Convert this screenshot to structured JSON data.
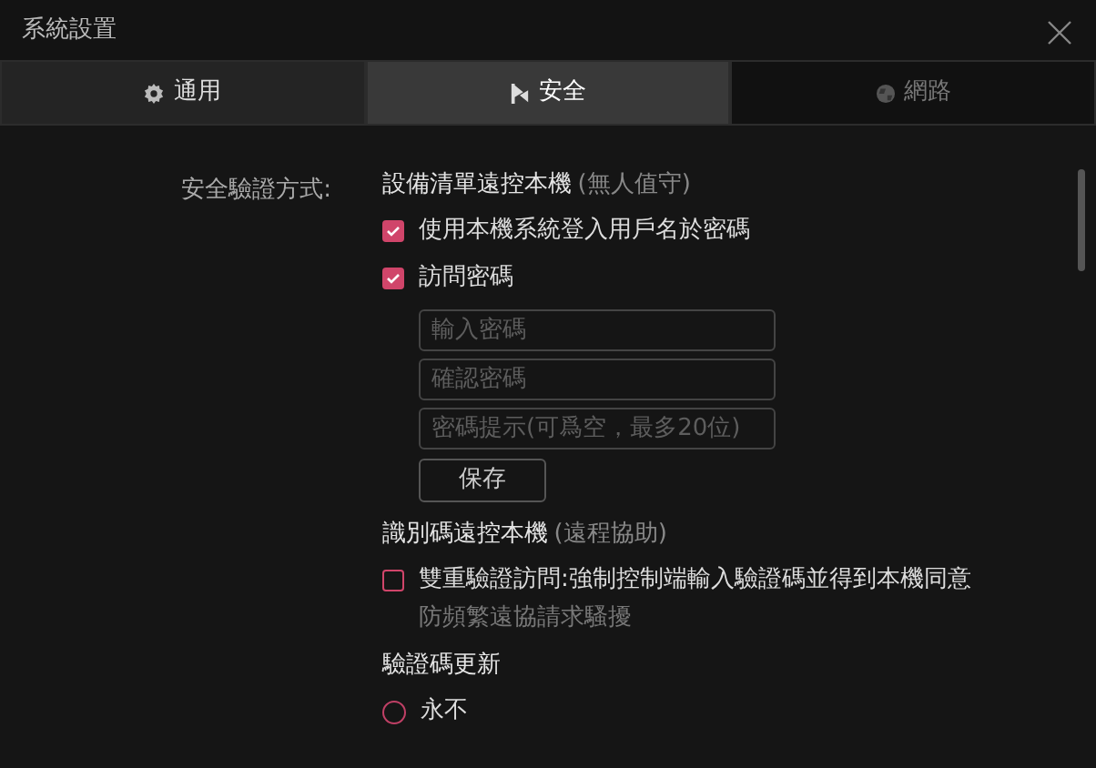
{
  "window": {
    "title": "系統設置"
  },
  "tabs": [
    {
      "label": "通用",
      "selected": false,
      "disabled": false
    },
    {
      "label": "安全",
      "selected": true,
      "disabled": false
    },
    {
      "label": "網路",
      "selected": false,
      "disabled": true
    }
  ],
  "security": {
    "label": "安全驗證方式:",
    "sections": [
      {
        "title": "設備清單遠控本機",
        "note": "(無人值守)",
        "items": [
          {
            "kind": "checkbox",
            "label": "使用本機系統登入用戶名於密碼",
            "checked": true
          },
          {
            "kind": "checkbox",
            "label": "訪問密碼",
            "checked": true,
            "fields": [
              {
                "placeholder": "輸入密碼"
              },
              {
                "placeholder": "確認密碼"
              },
              {
                "placeholder": "密碼提示(可爲空，最多20位)"
              }
            ],
            "button": "保存"
          }
        ]
      },
      {
        "title": "識別碼遠控本機",
        "note": "(遠程協助)",
        "items": [
          {
            "kind": "checkbox",
            "label": "雙重驗證訪問:強制控制端輸入驗證碼並得到本機同意",
            "checked": false,
            "hint": "防頻繁遠協請求騷擾"
          }
        ]
      },
      {
        "title": "驗證碼更新",
        "items": [
          {
            "kind": "radio",
            "label": "永不",
            "selected": false
          }
        ]
      }
    ]
  }
}
